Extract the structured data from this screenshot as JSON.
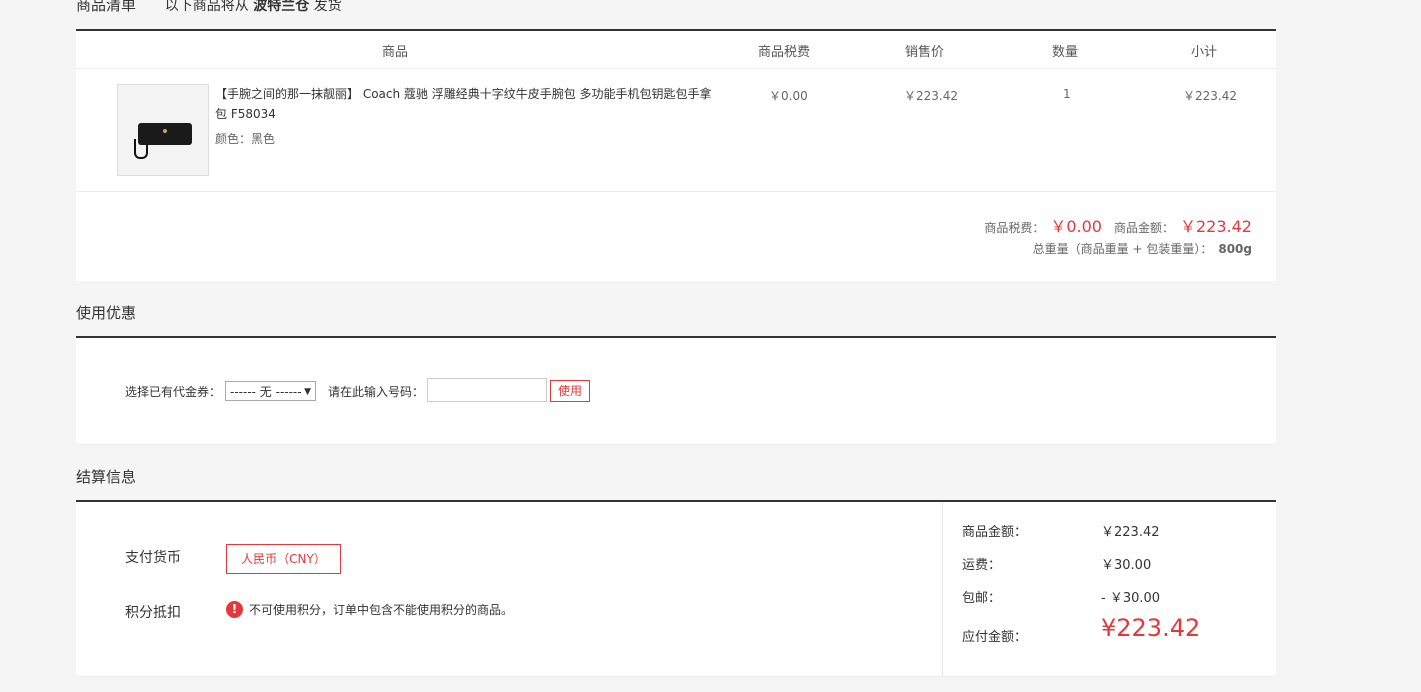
{
  "list": {
    "title": "商品清单",
    "ship_prefix": "以下商品将从",
    "warehouse": "波特兰仓",
    "ship_suffix": "发货"
  },
  "table": {
    "headers": [
      "商品",
      "商品税费",
      "销售价",
      "数量",
      "小计"
    ],
    "row": {
      "name": "【手腕之间的那一抹靓丽】 Coach 蔻驰 浮雕经典十字纹牛皮手腕包 多功能手机包钥匙包手拿包 F58034",
      "color": "颜色：黑色",
      "tax": "￥0.00",
      "price": "￥223.42",
      "qty": "1",
      "subtotal": "￥223.42"
    },
    "summary": {
      "tax_label": "商品税费：",
      "tax_value": "￥0.00",
      "amount_label": "商品金额：",
      "amount_value": "￥223.42",
      "weight_label": "总重量（商品重量 + 包装重量）：",
      "weight_value": "800g"
    }
  },
  "coupon": {
    "title": "使用优惠",
    "select_label": "选择已有代金券：",
    "select_value": "------ 无 ------",
    "code_label": "请在此输入号码：",
    "code_value": "",
    "use_button": "使用"
  },
  "settle": {
    "title": "结算信息",
    "currency_label": "支付货币",
    "currency_value": "人民币（CNY）",
    "points_label": "积分抵扣",
    "points_warning": "不可使用积分，订单中包含不能使用积分的商品。",
    "items_label": "商品金额：",
    "items_value": "￥223.42",
    "shipping_label": "运费：",
    "shipping_value": "￥30.00",
    "free_label": "包邮：",
    "free_value": "- ￥30.00",
    "total_label": "应付金额：",
    "total_value": "¥223.42"
  },
  "colors": {
    "accent": "#e4393c",
    "border_dark": "#333333",
    "page_bg": "#f5f5f5"
  }
}
